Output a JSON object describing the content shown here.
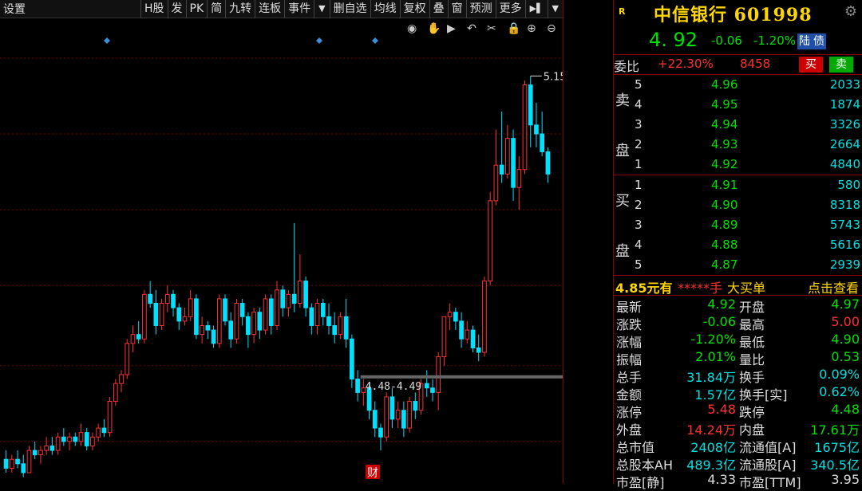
{
  "toolbar": {
    "left_label": "设置",
    "buttons": [
      "H股",
      "发",
      "PK",
      "简",
      "九转",
      "连板",
      "事件",
      "▼",
      "删自选",
      "均线",
      "复权",
      "叠",
      "窗",
      "预测",
      "更多",
      "▶▌",
      "▼"
    ]
  },
  "chart_icons": [
    "eye-icon",
    "hand-icon",
    "play-icon",
    "undo-icon",
    "scissors-icon",
    "lock-icon",
    "zoom-in-icon",
    "zoom-out-icon"
  ],
  "chart_data": {
    "type": "candlestick",
    "y_ticks": [
      "5.20",
      "5.03",
      "4.86",
      "4.69",
      "4.51",
      "4.34"
    ],
    "ylim": [
      4.27,
      5.25
    ],
    "high_annotation": "5.15",
    "support_label": "4.48-4.49",
    "support_level": 4.485,
    "marker_label": "财",
    "up_color": "#ff3030",
    "down_color": "#00e0ff",
    "candles": [
      {
        "o": 4.3,
        "h": 4.32,
        "l": 4.27,
        "c": 4.28
      },
      {
        "o": 4.28,
        "h": 4.31,
        "l": 4.27,
        "c": 4.3
      },
      {
        "o": 4.3,
        "h": 4.32,
        "l": 4.28,
        "c": 4.29
      },
      {
        "o": 4.29,
        "h": 4.31,
        "l": 4.26,
        "c": 4.27
      },
      {
        "o": 4.27,
        "h": 4.33,
        "l": 4.27,
        "c": 4.32
      },
      {
        "o": 4.32,
        "h": 4.34,
        "l": 4.3,
        "c": 4.31
      },
      {
        "o": 4.31,
        "h": 4.33,
        "l": 4.29,
        "c": 4.32
      },
      {
        "o": 4.32,
        "h": 4.35,
        "l": 4.31,
        "c": 4.33
      },
      {
        "o": 4.33,
        "h": 4.35,
        "l": 4.31,
        "c": 4.32
      },
      {
        "o": 4.32,
        "h": 4.36,
        "l": 4.31,
        "c": 4.35
      },
      {
        "o": 4.35,
        "h": 4.37,
        "l": 4.33,
        "c": 4.34
      },
      {
        "o": 4.34,
        "h": 4.36,
        "l": 4.32,
        "c": 4.35
      },
      {
        "o": 4.35,
        "h": 4.36,
        "l": 4.33,
        "c": 4.34
      },
      {
        "o": 4.34,
        "h": 4.38,
        "l": 4.33,
        "c": 4.36
      },
      {
        "o": 4.36,
        "h": 4.37,
        "l": 4.32,
        "c": 4.33
      },
      {
        "o": 4.33,
        "h": 4.36,
        "l": 4.32,
        "c": 4.35
      },
      {
        "o": 4.35,
        "h": 4.38,
        "l": 4.34,
        "c": 4.37
      },
      {
        "o": 4.37,
        "h": 4.39,
        "l": 4.35,
        "c": 4.36
      },
      {
        "o": 4.36,
        "h": 4.44,
        "l": 4.35,
        "c": 4.43
      },
      {
        "o": 4.43,
        "h": 4.48,
        "l": 4.42,
        "c": 4.47
      },
      {
        "o": 4.47,
        "h": 4.5,
        "l": 4.45,
        "c": 4.49
      },
      {
        "o": 4.49,
        "h": 4.57,
        "l": 4.48,
        "c": 4.56
      },
      {
        "o": 4.56,
        "h": 4.6,
        "l": 4.54,
        "c": 4.58
      },
      {
        "o": 4.58,
        "h": 4.61,
        "l": 4.56,
        "c": 4.57
      },
      {
        "o": 4.57,
        "h": 4.68,
        "l": 4.56,
        "c": 4.67
      },
      {
        "o": 4.67,
        "h": 4.7,
        "l": 4.64,
        "c": 4.65
      },
      {
        "o": 4.65,
        "h": 4.68,
        "l": 4.58,
        "c": 4.6
      },
      {
        "o": 4.6,
        "h": 4.66,
        "l": 4.59,
        "c": 4.65
      },
      {
        "o": 4.65,
        "h": 4.69,
        "l": 4.63,
        "c": 4.67
      },
      {
        "o": 4.67,
        "h": 4.68,
        "l": 4.62,
        "c": 4.64
      },
      {
        "o": 4.64,
        "h": 4.65,
        "l": 4.59,
        "c": 4.61
      },
      {
        "o": 4.61,
        "h": 4.64,
        "l": 4.6,
        "c": 4.62
      },
      {
        "o": 4.62,
        "h": 4.68,
        "l": 4.61,
        "c": 4.66
      },
      {
        "o": 4.66,
        "h": 4.67,
        "l": 4.57,
        "c": 4.58
      },
      {
        "o": 4.58,
        "h": 4.62,
        "l": 4.56,
        "c": 4.6
      },
      {
        "o": 4.6,
        "h": 4.61,
        "l": 4.57,
        "c": 4.59
      },
      {
        "o": 4.59,
        "h": 4.6,
        "l": 4.55,
        "c": 4.56
      },
      {
        "o": 4.56,
        "h": 4.67,
        "l": 4.55,
        "c": 4.66
      },
      {
        "o": 4.66,
        "h": 4.67,
        "l": 4.6,
        "c": 4.61
      },
      {
        "o": 4.61,
        "h": 4.63,
        "l": 4.55,
        "c": 4.57
      },
      {
        "o": 4.57,
        "h": 4.66,
        "l": 4.56,
        "c": 4.65
      },
      {
        "o": 4.65,
        "h": 4.66,
        "l": 4.6,
        "c": 4.62
      },
      {
        "o": 4.62,
        "h": 4.63,
        "l": 4.55,
        "c": 4.58
      },
      {
        "o": 4.58,
        "h": 4.64,
        "l": 4.56,
        "c": 4.63
      },
      {
        "o": 4.63,
        "h": 4.64,
        "l": 4.57,
        "c": 4.59
      },
      {
        "o": 4.59,
        "h": 4.67,
        "l": 4.58,
        "c": 4.66
      },
      {
        "o": 4.66,
        "h": 4.67,
        "l": 4.58,
        "c": 4.6
      },
      {
        "o": 4.6,
        "h": 4.7,
        "l": 4.59,
        "c": 4.68
      },
      {
        "o": 4.68,
        "h": 4.69,
        "l": 4.62,
        "c": 4.64
      },
      {
        "o": 4.64,
        "h": 4.68,
        "l": 4.62,
        "c": 4.67
      },
      {
        "o": 4.67,
        "h": 4.83,
        "l": 4.63,
        "c": 4.65
      },
      {
        "o": 4.65,
        "h": 4.76,
        "l": 4.64,
        "c": 4.7
      },
      {
        "o": 4.7,
        "h": 4.71,
        "l": 4.62,
        "c": 4.64
      },
      {
        "o": 4.64,
        "h": 4.65,
        "l": 4.58,
        "c": 4.6
      },
      {
        "o": 4.6,
        "h": 4.66,
        "l": 4.58,
        "c": 4.65
      },
      {
        "o": 4.65,
        "h": 4.66,
        "l": 4.6,
        "c": 4.62
      },
      {
        "o": 4.62,
        "h": 4.65,
        "l": 4.58,
        "c": 4.6
      },
      {
        "o": 4.6,
        "h": 4.63,
        "l": 4.56,
        "c": 4.58
      },
      {
        "o": 4.58,
        "h": 4.63,
        "l": 4.57,
        "c": 4.62
      },
      {
        "o": 4.62,
        "h": 4.66,
        "l": 4.55,
        "c": 4.57
      },
      {
        "o": 4.57,
        "h": 4.58,
        "l": 4.46,
        "c": 4.48
      },
      {
        "o": 4.48,
        "h": 4.5,
        "l": 4.43,
        "c": 4.45
      },
      {
        "o": 4.45,
        "h": 4.48,
        "l": 4.42,
        "c": 4.46
      },
      {
        "o": 4.46,
        "h": 4.47,
        "l": 4.39,
        "c": 4.41
      },
      {
        "o": 4.41,
        "h": 4.43,
        "l": 4.35,
        "c": 4.37
      },
      {
        "o": 4.37,
        "h": 4.38,
        "l": 4.32,
        "c": 4.35
      },
      {
        "o": 4.35,
        "h": 4.45,
        "l": 4.34,
        "c": 4.44
      },
      {
        "o": 4.44,
        "h": 4.46,
        "l": 4.37,
        "c": 4.39
      },
      {
        "o": 4.39,
        "h": 4.43,
        "l": 4.37,
        "c": 4.41
      },
      {
        "o": 4.41,
        "h": 4.43,
        "l": 4.35,
        "c": 4.37
      },
      {
        "o": 4.37,
        "h": 4.44,
        "l": 4.36,
        "c": 4.43
      },
      {
        "o": 4.43,
        "h": 4.45,
        "l": 4.39,
        "c": 4.41
      },
      {
        "o": 4.41,
        "h": 4.48,
        "l": 4.4,
        "c": 4.47
      },
      {
        "o": 4.47,
        "h": 4.5,
        "l": 4.44,
        "c": 4.46
      },
      {
        "o": 4.46,
        "h": 4.48,
        "l": 4.43,
        "c": 4.45
      },
      {
        "o": 4.45,
        "h": 4.54,
        "l": 4.41,
        "c": 4.53
      },
      {
        "o": 4.53,
        "h": 4.62,
        "l": 4.51,
        "c": 4.62
      },
      {
        "o": 4.62,
        "h": 4.65,
        "l": 4.59,
        "c": 4.63
      },
      {
        "o": 4.63,
        "h": 4.64,
        "l": 4.59,
        "c": 4.61
      },
      {
        "o": 4.61,
        "h": 4.63,
        "l": 4.55,
        "c": 4.57
      },
      {
        "o": 4.57,
        "h": 4.61,
        "l": 4.56,
        "c": 4.59
      },
      {
        "o": 4.59,
        "h": 4.6,
        "l": 4.54,
        "c": 4.55
      },
      {
        "o": 4.55,
        "h": 4.58,
        "l": 4.52,
        "c": 4.54
      },
      {
        "o": 4.54,
        "h": 4.71,
        "l": 4.53,
        "c": 4.7
      },
      {
        "o": 4.7,
        "h": 4.9,
        "l": 4.69,
        "c": 4.88
      },
      {
        "o": 4.88,
        "h": 5.04,
        "l": 4.87,
        "c": 4.96
      },
      {
        "o": 4.96,
        "h": 5.08,
        "l": 4.92,
        "c": 4.94
      },
      {
        "o": 4.94,
        "h": 5.05,
        "l": 4.93,
        "c": 5.02
      },
      {
        "o": 5.02,
        "h": 5.04,
        "l": 4.88,
        "c": 4.91
      },
      {
        "o": 4.91,
        "h": 4.98,
        "l": 4.86,
        "c": 4.95
      },
      {
        "o": 4.95,
        "h": 5.15,
        "l": 4.94,
        "c": 5.14
      },
      {
        "o": 5.14,
        "h": 5.16,
        "l": 5.0,
        "c": 5.05
      },
      {
        "o": 5.05,
        "h": 5.1,
        "l": 5.0,
        "c": 5.03
      },
      {
        "o": 5.03,
        "h": 5.08,
        "l": 4.98,
        "c": 4.99
      },
      {
        "o": 4.99,
        "h": 5.0,
        "l": 4.92,
        "c": 4.94
      }
    ]
  },
  "header": {
    "r_badge": "R",
    "name": "中信银行 601998",
    "price": "4. 92",
    "change": "-0.06",
    "change_pct": "-1.20%",
    "tags": [
      "陆",
      "债"
    ]
  },
  "weibi": {
    "label": "委比",
    "pct": "+22.30%",
    "diff": "8458",
    "buy": "买",
    "sell": "卖"
  },
  "ask": {
    "label_top": "卖",
    "label_bottom": "盘",
    "rows": [
      {
        "lvl": "5",
        "price": "4.96",
        "qty": "2033"
      },
      {
        "lvl": "4",
        "price": "4.95",
        "qty": "1874"
      },
      {
        "lvl": "3",
        "price": "4.94",
        "qty": "3326"
      },
      {
        "lvl": "2",
        "price": "4.93",
        "qty": "2664"
      },
      {
        "lvl": "1",
        "price": "4.92",
        "qty": "4840"
      }
    ]
  },
  "bid": {
    "label_top": "买",
    "label_bottom": "盘",
    "rows": [
      {
        "lvl": "1",
        "price": "4.91",
        "qty": "580"
      },
      {
        "lvl": "2",
        "price": "4.90",
        "qty": "8318"
      },
      {
        "lvl": "3",
        "price": "4.89",
        "qty": "5743"
      },
      {
        "lvl": "4",
        "price": "4.88",
        "qty": "5616"
      },
      {
        "lvl": "5",
        "price": "4.87",
        "qty": "2939"
      }
    ]
  },
  "big_order": {
    "price": "4.85元有",
    "hidden": "*****手",
    "label": "大买单",
    "link": "点击查看"
  },
  "stats": [
    {
      "l1": "最新",
      "v1": "4.92",
      "c1": "green",
      "l2": "开盘",
      "v2": "4.97",
      "c2": "green"
    },
    {
      "l1": "涨跌",
      "v1": "-0.06",
      "c1": "green",
      "l2": "最高",
      "v2": "5.00",
      "c2": "red"
    },
    {
      "l1": "涨幅",
      "v1": "-1.20%",
      "c1": "green",
      "l2": "最低",
      "v2": "4.90",
      "c2": "green"
    },
    {
      "l1": "振幅",
      "v1": "2.01%",
      "c1": "green",
      "l2": "量比",
      "v2": "0.53",
      "c2": "green"
    },
    {
      "l1": "总手",
      "v1": "31.84万",
      "c1": "cyan",
      "l2": "换手",
      "v2": "0.09%",
      "c2": "cyan"
    },
    {
      "l1": "金额",
      "v1": "1.57亿",
      "c1": "cyan",
      "l2": "换手[实]",
      "v2": "0.62%",
      "c2": "cyan"
    },
    {
      "l1": "涨停",
      "v1": "5.48",
      "c1": "red",
      "l2": "跌停",
      "v2": "4.48",
      "c2": "green"
    },
    {
      "l1": "外盘",
      "v1": "14.24万",
      "c1": "red",
      "l2": "内盘",
      "v2": "17.61万",
      "c2": "green"
    },
    {
      "l1": "总市值",
      "v1": "2408亿",
      "c1": "cyan",
      "l2": "流通值[A]",
      "v2": "1675亿",
      "c2": "cyan"
    },
    {
      "l1": "总股本AH",
      "v1": "489.3亿",
      "c1": "cyan",
      "l2": "流通股[A]",
      "v2": "340.5亿",
      "c2": "cyan"
    },
    {
      "l1": "市盈[静]",
      "v1": "4.33",
      "c1": "white",
      "l2": "市盈[TTM]",
      "v2": "3.95",
      "c2": "white"
    }
  ]
}
